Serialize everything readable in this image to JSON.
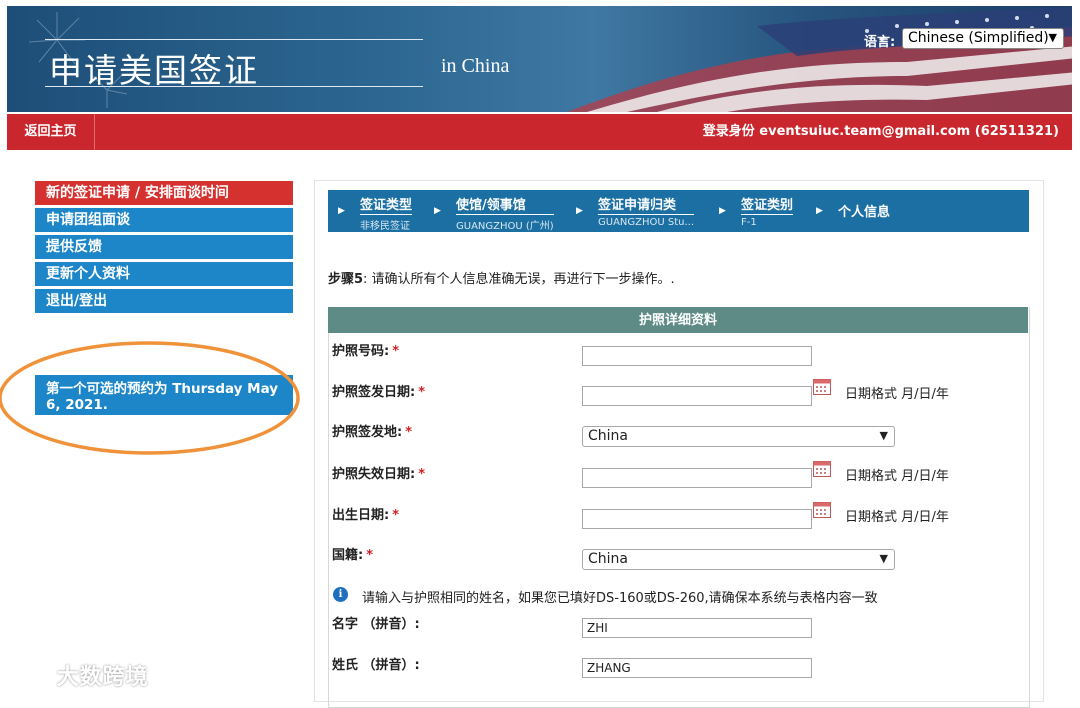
{
  "banner": {
    "title": "申请美国签证",
    "subtitle": "in China",
    "language_label": "语言:",
    "language_value": "Chinese (Simplified)"
  },
  "topbar": {
    "home_label": "返回主页",
    "login_text": "登录身份  eventsuiuc.team@gmail.com (62511321)"
  },
  "sidebar": {
    "items": [
      {
        "label": "新的签证申请 / 安排面谈时间"
      },
      {
        "label": "申请团组面谈"
      },
      {
        "label": "提供反馈"
      },
      {
        "label": "更新个人资料"
      },
      {
        "label": "退出/登出"
      }
    ],
    "appointment": "第一个可选的预约为 Thursday May 6, 2021."
  },
  "steps": [
    {
      "name": "签证类型",
      "value": "非移民签证"
    },
    {
      "name": "使馆/领事馆",
      "value": "GUANGZHOU (广州)"
    },
    {
      "name": "签证申请归类",
      "value": "GUANGZHOU Stu..."
    },
    {
      "name": "签证类别",
      "value": "F-1"
    },
    {
      "name": "个人信息",
      "value": ""
    }
  ],
  "instruction": {
    "step": "步骤5",
    "text": ": 请确认所有个人信息准确无误，再进行下一步操作。."
  },
  "form": {
    "section_title": "护照详细资料",
    "date_format": "日期格式 月/日/年",
    "passport_number_label": "护照号码:",
    "issue_date_label": "护照签发日期:",
    "issue_place_label": "护照签发地:",
    "issue_place_value": "China",
    "expiry_date_label": "护照失效日期:",
    "birth_date_label": "出生日期:",
    "nationality_label": "国籍:",
    "nationality_value": "China",
    "name_note": "请输入与护照相同的姓名，如果您已填好DS-160或DS-260,请确保本系统与表格内容一致",
    "given_name_label": "名字 （拼音）:",
    "given_name_value": "ZHI",
    "surname_label": "姓氏 （拼音）:",
    "surname_value": "ZHANG",
    "required_mark": "*"
  },
  "watermark": "大数跨境",
  "colors": {
    "red_bar": "#c9272d",
    "menu_blue": "#1d86c8",
    "menu_active": "#d5312f",
    "steps_blue": "#1b6fa2",
    "section_header": "#5e8b86",
    "highlight_ellipse": "#f0923a"
  }
}
